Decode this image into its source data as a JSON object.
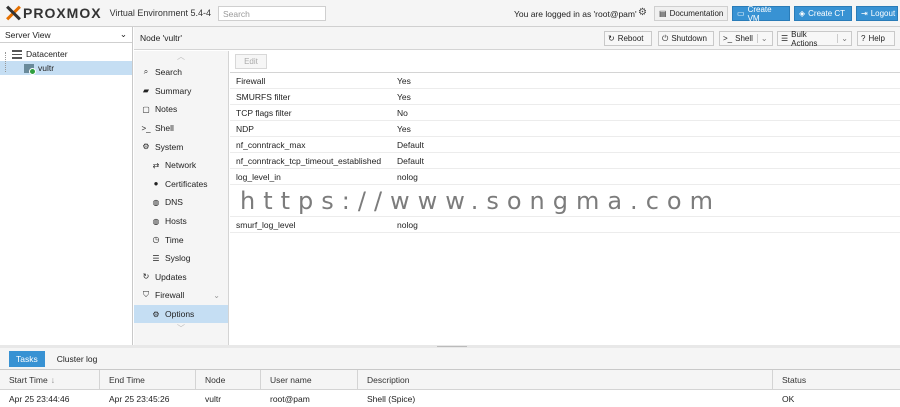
{
  "app": {
    "logo_text": "PROXMOX",
    "version": "Virtual Environment 5.4-4",
    "search_placeholder": "Search",
    "login_text": "You are logged in as 'root@pam'",
    "buttons": {
      "documentation": "Documentation",
      "create_vm": "Create VM",
      "create_ct": "Create CT",
      "logout": "Logout"
    }
  },
  "left_panel": {
    "view": "Server View",
    "tree": {
      "datacenter": "Datacenter",
      "node": "vultr"
    }
  },
  "node_header": {
    "title": "Node 'vultr'",
    "buttons": {
      "reboot": "Reboot",
      "shutdown": "Shutdown",
      "shell": "Shell",
      "bulk_actions": "Bulk Actions",
      "help": "Help"
    }
  },
  "subnav": {
    "items": [
      {
        "label": "Search"
      },
      {
        "label": "Summary"
      },
      {
        "label": "Notes"
      },
      {
        "label": "Shell"
      },
      {
        "label": "System"
      },
      {
        "label": "Network"
      },
      {
        "label": "Certificates"
      },
      {
        "label": "DNS"
      },
      {
        "label": "Hosts"
      },
      {
        "label": "Time"
      },
      {
        "label": "Syslog"
      },
      {
        "label": "Updates"
      },
      {
        "label": "Firewall"
      },
      {
        "label": "Options"
      }
    ]
  },
  "content": {
    "edit_label": "Edit",
    "rows": [
      {
        "key": "Firewall",
        "value": "Yes"
      },
      {
        "key": "SMURFS filter",
        "value": "Yes"
      },
      {
        "key": "TCP flags filter",
        "value": "No"
      },
      {
        "key": "NDP",
        "value": "Yes"
      },
      {
        "key": "nf_conntrack_max",
        "value": "Default"
      },
      {
        "key": "nf_conntrack_tcp_timeout_established",
        "value": "Default"
      },
      {
        "key": "log_level_in",
        "value": "nolog"
      },
      {
        "key": "smurf_log_level",
        "value": "nolog"
      }
    ]
  },
  "watermark": "https://www.songma.com",
  "tasks": {
    "tabs": {
      "tasks": "Tasks",
      "cluster_log": "Cluster log"
    },
    "columns": {
      "start_time": "Start Time",
      "end_time": "End Time",
      "node": "Node",
      "user": "User name",
      "description": "Description",
      "status": "Status"
    },
    "rows": [
      {
        "start": "Apr 25 23:44:46",
        "end": "Apr 25 23:45:26",
        "node": "vultr",
        "user": "root@pam",
        "description": "Shell (Spice)",
        "status": "OK"
      }
    ]
  },
  "colors": {
    "accent": "#3892d3",
    "selection": "#c5def3",
    "logo_orange": "#e57000"
  }
}
